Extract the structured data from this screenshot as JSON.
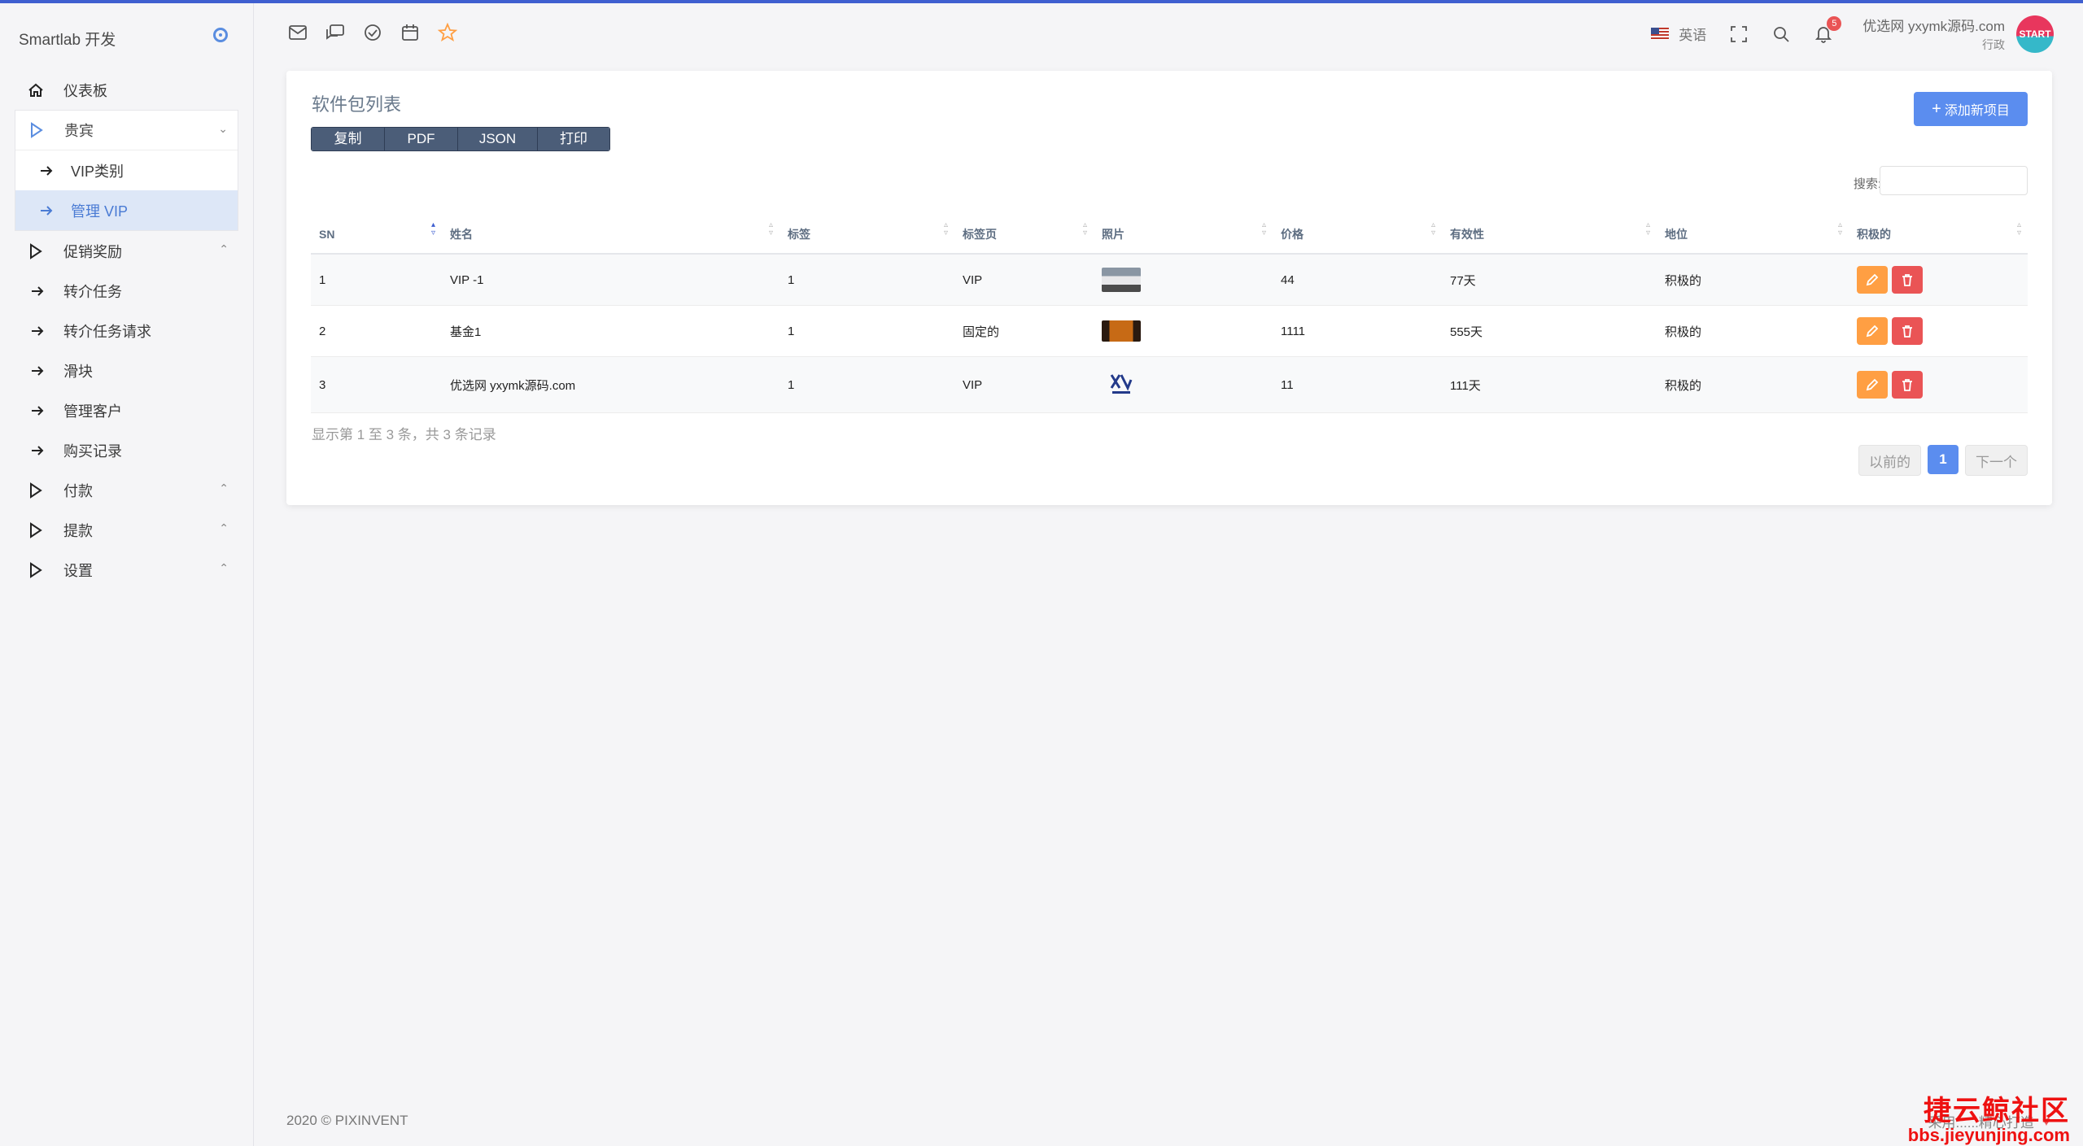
{
  "brand": "Smartlab 开发",
  "sidebar": {
    "items": [
      {
        "label": "仪表板"
      },
      {
        "label": "贵宾"
      },
      {
        "label": "VIP类别"
      },
      {
        "label": "管理 VIP"
      },
      {
        "label": "促销奖励"
      },
      {
        "label": "转介任务"
      },
      {
        "label": "转介任务请求"
      },
      {
        "label": "滑块"
      },
      {
        "label": "管理客户"
      },
      {
        "label": "购买记录"
      },
      {
        "label": "付款"
      },
      {
        "label": "提款"
      },
      {
        "label": "设置"
      }
    ]
  },
  "header": {
    "language": "英语",
    "notification_count": "5",
    "user_name": "优选网 yxymk源码.com",
    "user_role": "行政",
    "avatar_text": "START"
  },
  "card": {
    "title": "软件包列表",
    "export_buttons": [
      "复制",
      "PDF",
      "JSON",
      "打印"
    ],
    "add_button": "添加新项目",
    "search_label": "搜索:"
  },
  "table": {
    "headers": [
      "SN",
      "姓名",
      "标签",
      "标签页",
      "照片",
      "价格",
      "有效性",
      "地位",
      "积极的"
    ],
    "rows": [
      {
        "sn": "1",
        "name": "VIP -1",
        "tag": "1",
        "tab": "VIP",
        "price": "44",
        "validity": "77天",
        "status": "积极的"
      },
      {
        "sn": "2",
        "name": "基金1",
        "tag": "1",
        "tab": "固定的",
        "price": "1111",
        "validity": "555天",
        "status": "积极的"
      },
      {
        "sn": "3",
        "name": "优选网 yxymk源码.com",
        "tag": "1",
        "tab": "VIP",
        "price": "11",
        "validity": "111天",
        "status": "积极的"
      }
    ]
  },
  "pagination": {
    "info": "显示第 1 至 3 条，共 3 条记录",
    "prev": "以前的",
    "current": "1",
    "next": "下一个"
  },
  "footer": {
    "left": "2020 © PIXINVENT",
    "right": "采用......精心打造",
    "watermark_line1": "捷云鲸社区",
    "watermark_line2": "bbs.jieyunjing.com"
  },
  "colors": {
    "accent": "#5b8def",
    "edit": "#ff9f43",
    "delete": "#ea5455",
    "active_bg": "#dde7f7"
  }
}
